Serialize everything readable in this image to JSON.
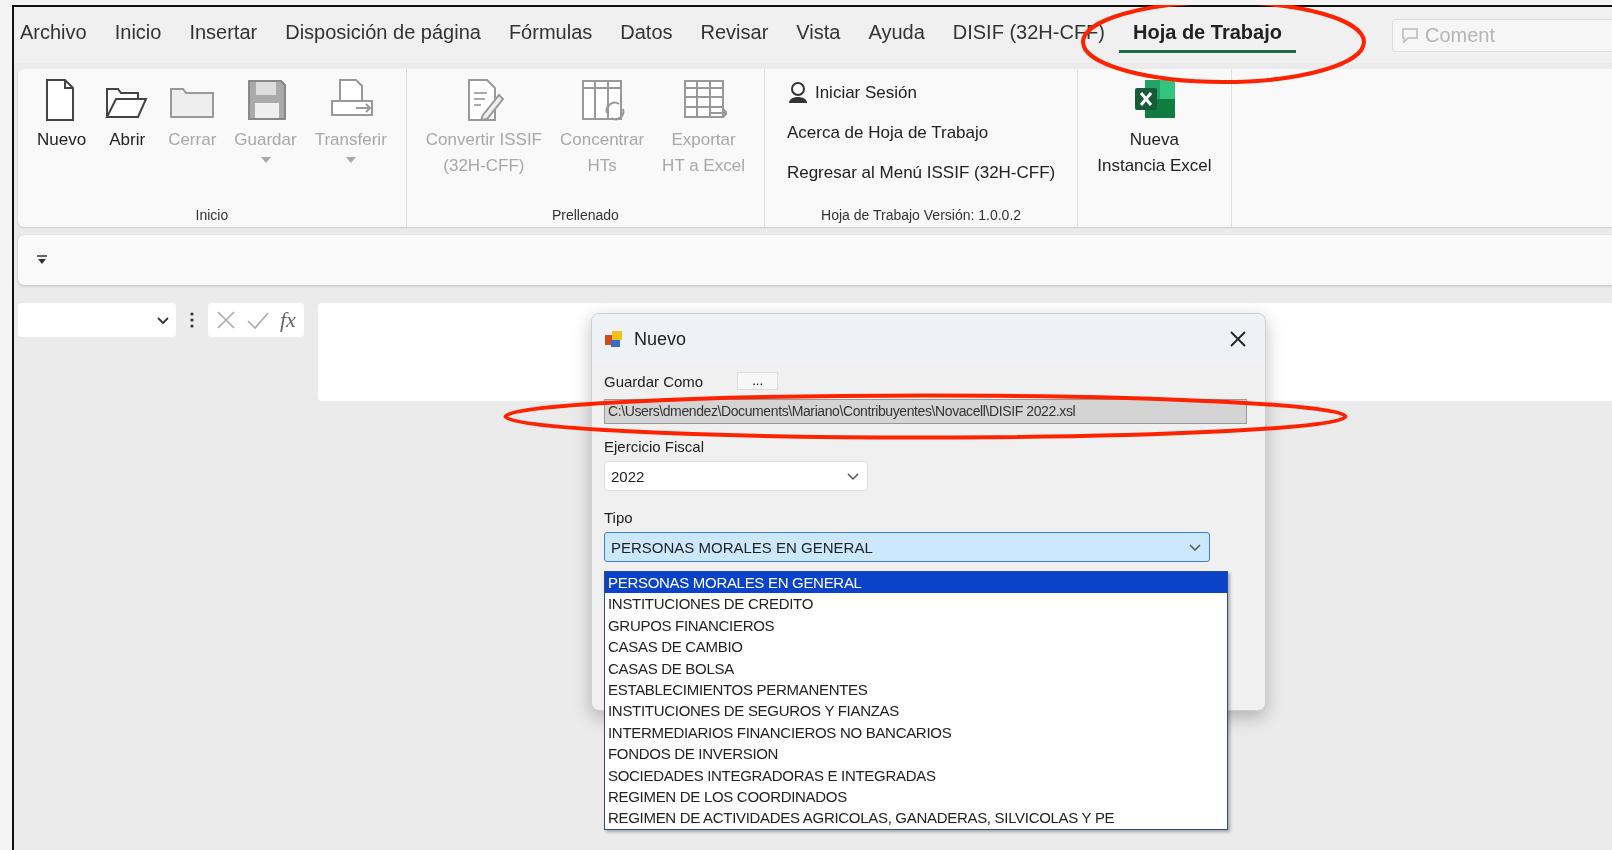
{
  "menu_tabs": [
    {
      "label": "Archivo",
      "selected": false
    },
    {
      "label": "Inicio",
      "selected": false
    },
    {
      "label": "Insertar",
      "selected": false
    },
    {
      "label": "Disposición de página",
      "selected": false
    },
    {
      "label": "Fórmulas",
      "selected": false
    },
    {
      "label": "Datos",
      "selected": false
    },
    {
      "label": "Revisar",
      "selected": false
    },
    {
      "label": "Vista",
      "selected": false
    },
    {
      "label": "Ayuda",
      "selected": false
    },
    {
      "label": "DISIF (32H-CFF)",
      "selected": false
    },
    {
      "label": "Hoja de Trabajo",
      "selected": true
    }
  ],
  "comments_button": {
    "label": "Coment",
    "disabled": true
  },
  "ribbon_groups": [
    {
      "kind": "buttons",
      "caption": "Inicio",
      "buttons": [
        {
          "label": "Nuevo",
          "disabled": false,
          "dropdown": false
        },
        {
          "label": "Abrir",
          "disabled": false,
          "dropdown": false
        },
        {
          "label": "Cerrar",
          "disabled": true,
          "dropdown": false
        },
        {
          "label": "Guardar",
          "disabled": true,
          "dropdown": true
        },
        {
          "label": "Transferir",
          "disabled": true,
          "dropdown": true
        }
      ]
    },
    {
      "kind": "buttons",
      "caption": "Prellenado",
      "buttons": [
        {
          "label": "Convertir ISSIF\n(32H-CFF)",
          "disabled": true,
          "dropdown": false
        },
        {
          "label": "Concentrar\nHTs",
          "disabled": true,
          "dropdown": false
        },
        {
          "label": "Exportar\nHT a Excel",
          "disabled": true,
          "dropdown": false
        }
      ]
    },
    {
      "kind": "links",
      "caption": "Hoja de Trabajo Versión: 1.0.0.2",
      "items": [
        {
          "label": "Iniciar Sesión"
        },
        {
          "label": "Acerca de Hoja de Trabajo"
        },
        {
          "label": "Regresar al Menú ISSIF (32H-CFF)"
        }
      ]
    },
    {
      "kind": "buttons",
      "buttons": [
        {
          "label": "Nueva\nInstancia Excel",
          "disabled": false,
          "dropdown": false
        }
      ]
    }
  ],
  "formula_bar": {
    "function_label": "fx"
  },
  "dialog": {
    "title": "Nuevo",
    "fields": [
      {
        "kind": "path",
        "label": "Guardar Como",
        "browse_label": "...",
        "value": "C:\\Users\\dmendez\\Documents\\Mariano\\Contribuyentes\\Novacell\\DISIF 2022.xsl",
        "disabled": true
      },
      {
        "kind": "select",
        "label": "Ejercicio Fiscal",
        "value": "2022",
        "open": false
      },
      {
        "kind": "select",
        "label": "Tipo",
        "value": "PERSONAS MORALES EN GENERAL",
        "open": true,
        "options": [
          {
            "label": "PERSONAS MORALES EN GENERAL",
            "selected": true
          },
          {
            "label": "INSTITUCIONES DE CREDITO",
            "selected": false
          },
          {
            "label": "GRUPOS FINANCIEROS",
            "selected": false
          },
          {
            "label": "CASAS DE CAMBIO",
            "selected": false
          },
          {
            "label": "CASAS DE BOLSA",
            "selected": false
          },
          {
            "label": "ESTABLECIMIENTOS PERMANENTES",
            "selected": false
          },
          {
            "label": "INSTITUCIONES DE SEGUROS Y FIANZAS",
            "selected": false
          },
          {
            "label": "INTERMEDIARIOS FINANCIEROS NO BANCARIOS",
            "selected": false
          },
          {
            "label": "FONDOS DE INVERSION",
            "selected": false
          },
          {
            "label": "SOCIEDADES INTEGRADORAS E INTEGRADAS",
            "selected": false
          },
          {
            "label": "REGIMEN DE LOS COORDINADOS",
            "selected": false
          },
          {
            "label": "REGIMEN DE ACTIVIDADES AGRICOLAS, GANADERAS, SILVICOLAS Y PE",
            "selected": false
          }
        ]
      }
    ]
  }
}
